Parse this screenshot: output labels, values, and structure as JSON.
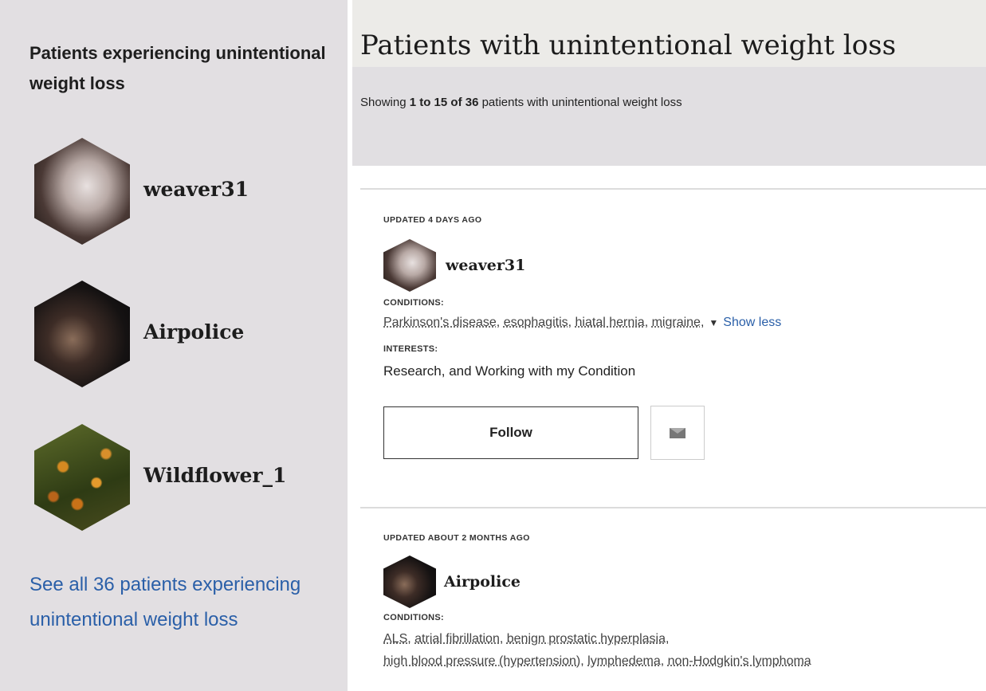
{
  "sidebar": {
    "title": "Patients experiencing unintentional weight loss",
    "patients": [
      {
        "name": "weaver31",
        "avatar": "profile-photo-icon"
      },
      {
        "name": "Airpolice",
        "avatar": "profile-photo-icon"
      },
      {
        "name": "Wildflower_1",
        "avatar": "flower-photo-icon"
      }
    ],
    "see_all": "See all 36 patients experiencing unintentional weight loss"
  },
  "main": {
    "title": "Patients with unintentional weight loss",
    "showing": {
      "prefix": "Showing ",
      "range": "1 to 15 of 36",
      "suffix": " patients with unintentional weight loss"
    },
    "cards": [
      {
        "updated": "UPDATED 4 DAYS AGO",
        "username": "weaver31",
        "conditions_label": "CONDITIONS:",
        "conditions": [
          "Parkinson's disease",
          "esophagitis",
          "hiatal hernia",
          "migraine"
        ],
        "show_less": "Show less",
        "interests_label": "INTERESTS:",
        "interests": "Research, and Working with my Condition",
        "follow": "Follow",
        "message_icon": "envelope-icon"
      },
      {
        "updated": "UPDATED ABOUT 2 MONTHS AGO",
        "username": "Airpolice",
        "conditions_label": "CONDITIONS:",
        "conditions_line1": [
          "ALS",
          "atrial fibrillation",
          "benign prostatic hyperplasia"
        ],
        "conditions_line2": [
          "high blood pressure (hypertension)",
          "lymphedema",
          "non-Hodgkin's lymphoma"
        ]
      }
    ]
  },
  "colors": {
    "sidebar_bg": "#e2dfe2",
    "link": "#2a5fa8",
    "band_bg": "#e1dfe2"
  }
}
